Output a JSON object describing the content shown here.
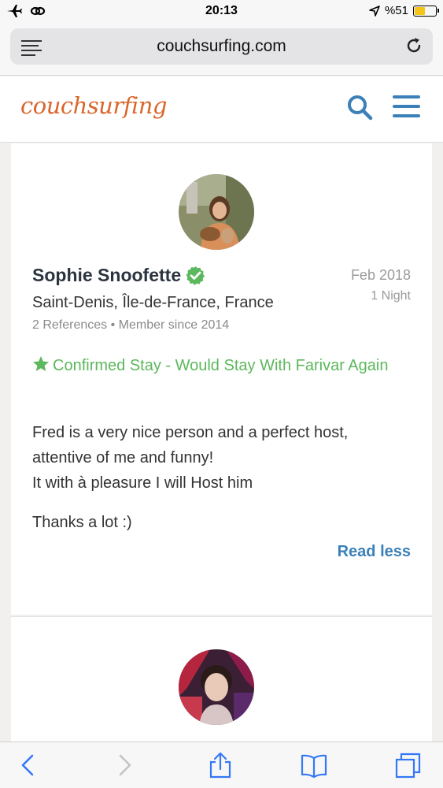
{
  "status_bar": {
    "time": "20:13",
    "battery_text": "%51",
    "battery_level": 0.51,
    "icons": [
      "airplane-icon",
      "link-icon",
      "location-arrow-icon",
      "battery-icon"
    ]
  },
  "browser": {
    "url": "couchsurfing.com",
    "icons": [
      "reader-menu-icon",
      "reload-icon"
    ]
  },
  "site_header": {
    "logo_text": "couchsurfing",
    "icons": [
      "search-icon",
      "hamburger-menu-icon"
    ],
    "colors": {
      "logo": "#d9662a",
      "accent": "#3b80b9"
    }
  },
  "reference": {
    "name": "Sophie Snoofette",
    "date": "Feb 2018",
    "nights": "1 Night",
    "location": "Saint-Denis, Île-de-France, France",
    "meta": "2 References • Member since 2014",
    "confirmed": "Confirmed Stay - Would Stay With Farivar Again",
    "body_line1": "Fred is a very nice person and a perfect host,",
    "body_line2": "attentive of me and funny!",
    "body_line3": "It with à pleasure I will Host him",
    "thanks": "Thanks a lot :)",
    "read_less": "Read less",
    "colors": {
      "confirmed": "#5cb85c",
      "verified": "#5cb85c"
    }
  },
  "toolbar": {
    "icons": [
      "back-icon",
      "forward-icon",
      "share-icon",
      "bookmarks-icon",
      "tabs-icon"
    ]
  }
}
